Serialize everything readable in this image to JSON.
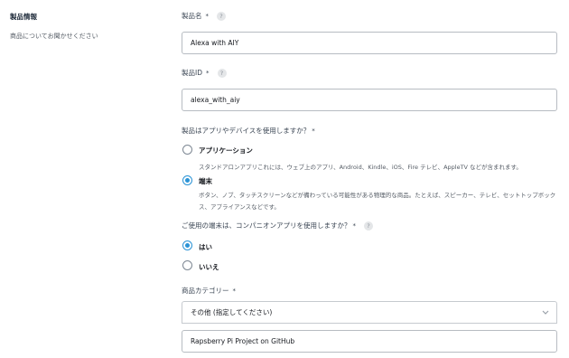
{
  "section": {
    "title": "製品情報",
    "description": "商品についてお聞かせください"
  },
  "product_name": {
    "label": "製品名",
    "required_mark": "*",
    "help_icon": "?",
    "value": "Alexa with AIY"
  },
  "product_id": {
    "label": "製品ID",
    "required_mark": "*",
    "help_icon": "?",
    "value": "alexa_with_aiy"
  },
  "uses_app_or_device": {
    "question": "製品はアプリやデバイスを使用しますか？",
    "required_mark": "*",
    "options": [
      {
        "label": "アプリケーション",
        "description": "スタンドアロンアプリこれには、ウェブ上のアプリ、Android、Kindle、iOS、Fire テレビ、AppleTV などが含まれます。",
        "selected": false
      },
      {
        "label": "端末",
        "description": "ボタン、ノブ、タッチスクリーンなどが備わっている可能性がある物理的な商品。たとえば、スピーカー、テレビ、セットトップボックス、アプライアンスなどです。",
        "selected": true
      }
    ]
  },
  "companion_app": {
    "question": "ご使用の端末は、コンパニオンアプリを使用しますか？",
    "required_mark": "*",
    "help_icon": "?",
    "options": [
      {
        "label": "はい",
        "selected": true
      },
      {
        "label": "いいえ",
        "selected": false
      }
    ]
  },
  "category": {
    "label": "商品カテゴリー",
    "required_mark": "*",
    "selected": "その他 (指定してください)",
    "other_value": "Rapsberry Pi Project on GitHub"
  },
  "colors": {
    "accent": "#2a93d6",
    "text": "#16191f",
    "border": "#b7bcc2"
  }
}
